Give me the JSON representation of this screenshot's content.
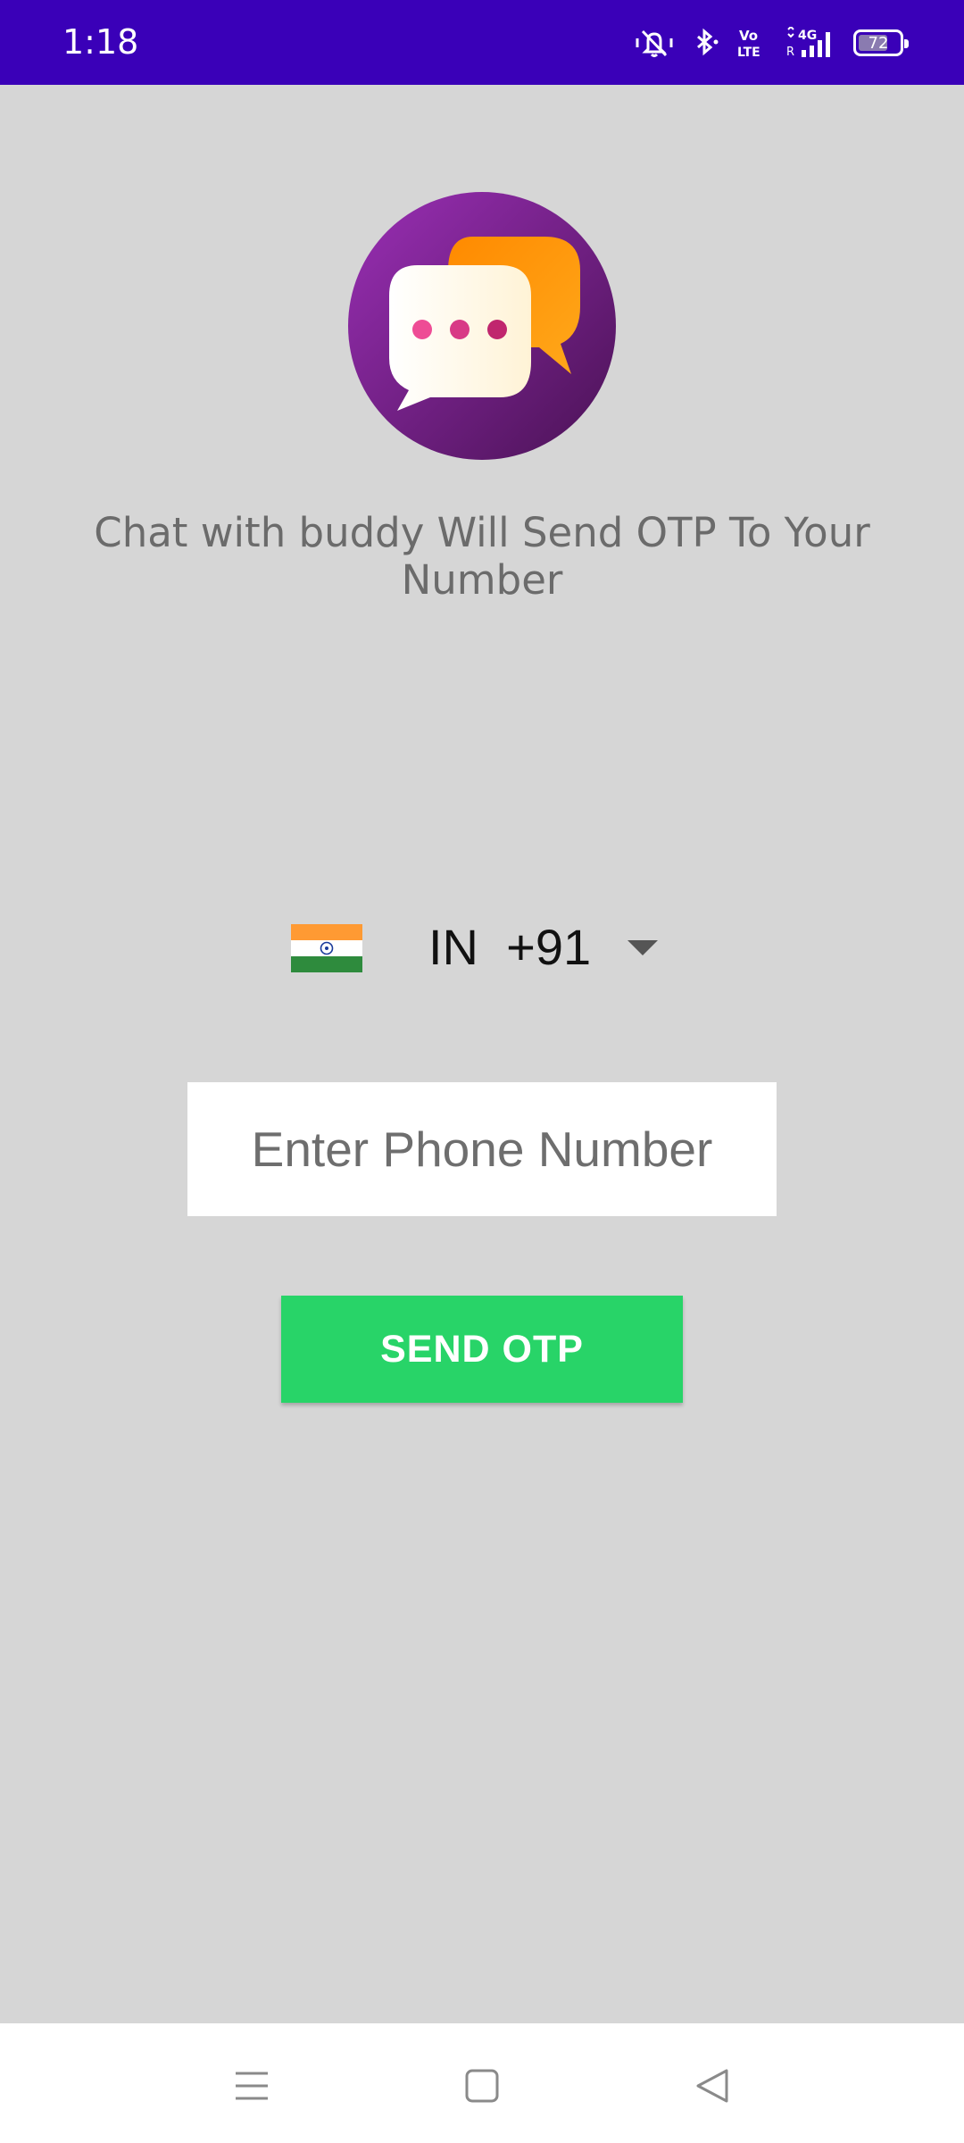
{
  "status_bar": {
    "time": "1:18",
    "battery_level": "72",
    "battery_fraction": 0.72,
    "icons": [
      "vibrate-mute-icon",
      "bluetooth-icon",
      "volte-icon",
      "4g-signal-icon",
      "battery-icon"
    ],
    "network_label": "4G",
    "volte_label_top": "Vo",
    "volte_label_bottom": "LTE",
    "background_color": "#3a00b8"
  },
  "logo": {
    "icon": "chat-bubbles-icon",
    "circle_color": "#7b2396",
    "accent_color": "#ff9a0a"
  },
  "headline": "Chat with buddy Will Send OTP To Your Number",
  "country_picker": {
    "flag": "india-flag-icon",
    "country_code": "IN",
    "dial_code": "+91",
    "display": "IN  +91"
  },
  "phone_input": {
    "placeholder": "Enter Phone Number",
    "value": ""
  },
  "send_button": {
    "label": "SEND OTP",
    "color": "#28d468"
  },
  "nav_bar": {
    "buttons": [
      "menu-icon",
      "home-icon",
      "back-icon"
    ]
  }
}
